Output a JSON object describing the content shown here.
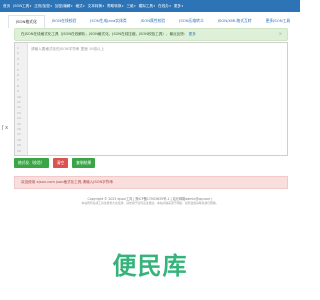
{
  "nav": {
    "items": [
      {
        "label": "首页",
        "caret": false
      },
      {
        "label": "JSON工具",
        "caret": true
      },
      {
        "label": "正则/加密",
        "caret": true
      },
      {
        "label": "加密/编解",
        "caret": true
      },
      {
        "label": "格式",
        "caret": true
      },
      {
        "label": "文本转换",
        "caret": true
      },
      {
        "label": "帮助转换",
        "caret": true
      },
      {
        "label": "三维",
        "caret": true
      },
      {
        "label": "模拟工具",
        "caret": true
      },
      {
        "label": "在线办",
        "caret": true
      },
      {
        "label": "更多",
        "caret": true
      }
    ]
  },
  "subnav": {
    "tabs": [
      {
        "label": "JSON格式化",
        "active": true
      },
      {
        "label": "JSON在线校验",
        "active": false
      },
      {
        "label": "JSON生成Java实体类",
        "active": false
      },
      {
        "label": "JSON属性校验",
        "active": false
      },
      {
        "label": "JSON压缩转义",
        "active": false
      },
      {
        "label": "JSON/XML格式互转",
        "active": false
      },
      {
        "label": "更多JSON工具",
        "active": false
      }
    ]
  },
  "info_alert": {
    "text": "在JSON在线格式化工具（JSON在线解析，JSON格式化，JSON在线压缩，JSON校验工具），最近反馈：",
    "link": "更多"
  },
  "editor": {
    "placeholder": "请输入要格式化的JSON字符串 提速 10倍以上",
    "line_numbers": [
      "1",
      "2",
      "3",
      "4",
      "5",
      "6",
      "7",
      "8",
      "9",
      "10",
      "11",
      "12",
      "13",
      "14",
      "15",
      "16",
      "17",
      "18",
      "19",
      "20"
    ]
  },
  "side_toggle": "ʃ x",
  "buttons": {
    "format": "格式化（校验）",
    "clear": "清空",
    "copy": "复制结果"
  },
  "danger_alert": {
    "text": "欢迎使用 ejson.com json格式化工具,请输入JSON字符串"
  },
  "footer": {
    "line1": "Copyright © 2023 ejson工具 | 豫ICP备17003635号-1 | 站长邮箱admin@qq.com |",
    "line2": "本站所有在线工具免费供大家使用，请勿用于任何违法用途。本站内容来源于网络，如有侵权请联系我们删除。"
  },
  "watermark": "便民库",
  "colors": {
    "nav_bg": "#2d74b7",
    "success": "#39a546",
    "danger": "#d9534f",
    "info_bg": "#dff0d8",
    "danger_bg": "#f9dede",
    "watermark": "#35b37a"
  }
}
